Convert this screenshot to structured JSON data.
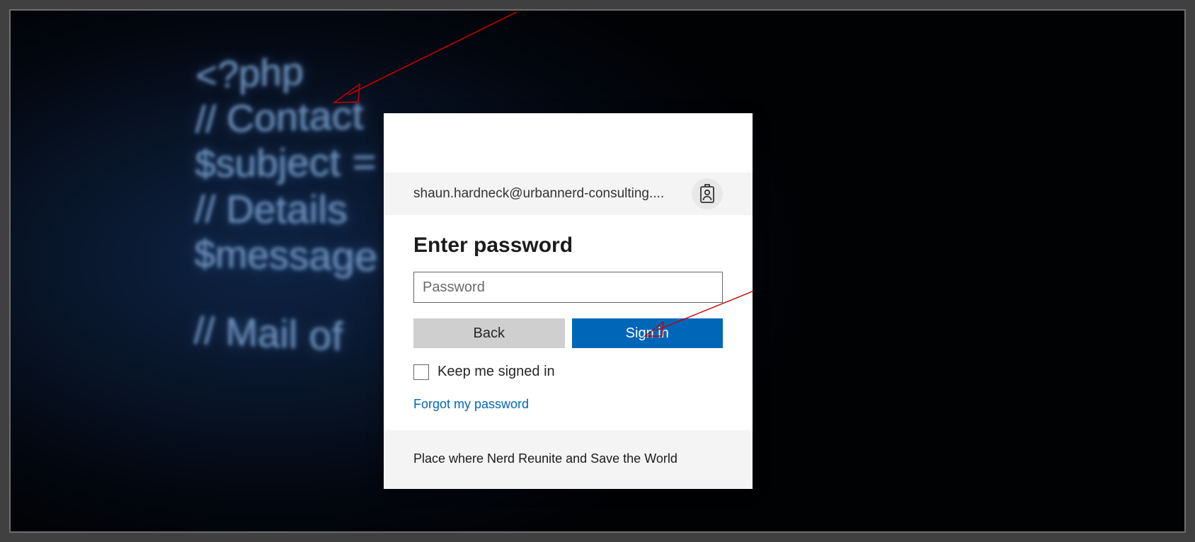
{
  "background": {
    "code_lines": [
      "<?php",
      "// Contact",
      "$subject =",
      "// Details",
      "$message",
      "",
      "// Mail of"
    ]
  },
  "login": {
    "email": "shaun.hardneck@urbannerd-consulting....",
    "heading": "Enter password",
    "password_placeholder": "Password",
    "back_label": "Back",
    "signin_label": "Sign in",
    "keep_signed_label": "Keep me signed in",
    "forgot_label": "Forgot my password",
    "footer_text": "Place where Nerd Reunite and Save the World"
  }
}
